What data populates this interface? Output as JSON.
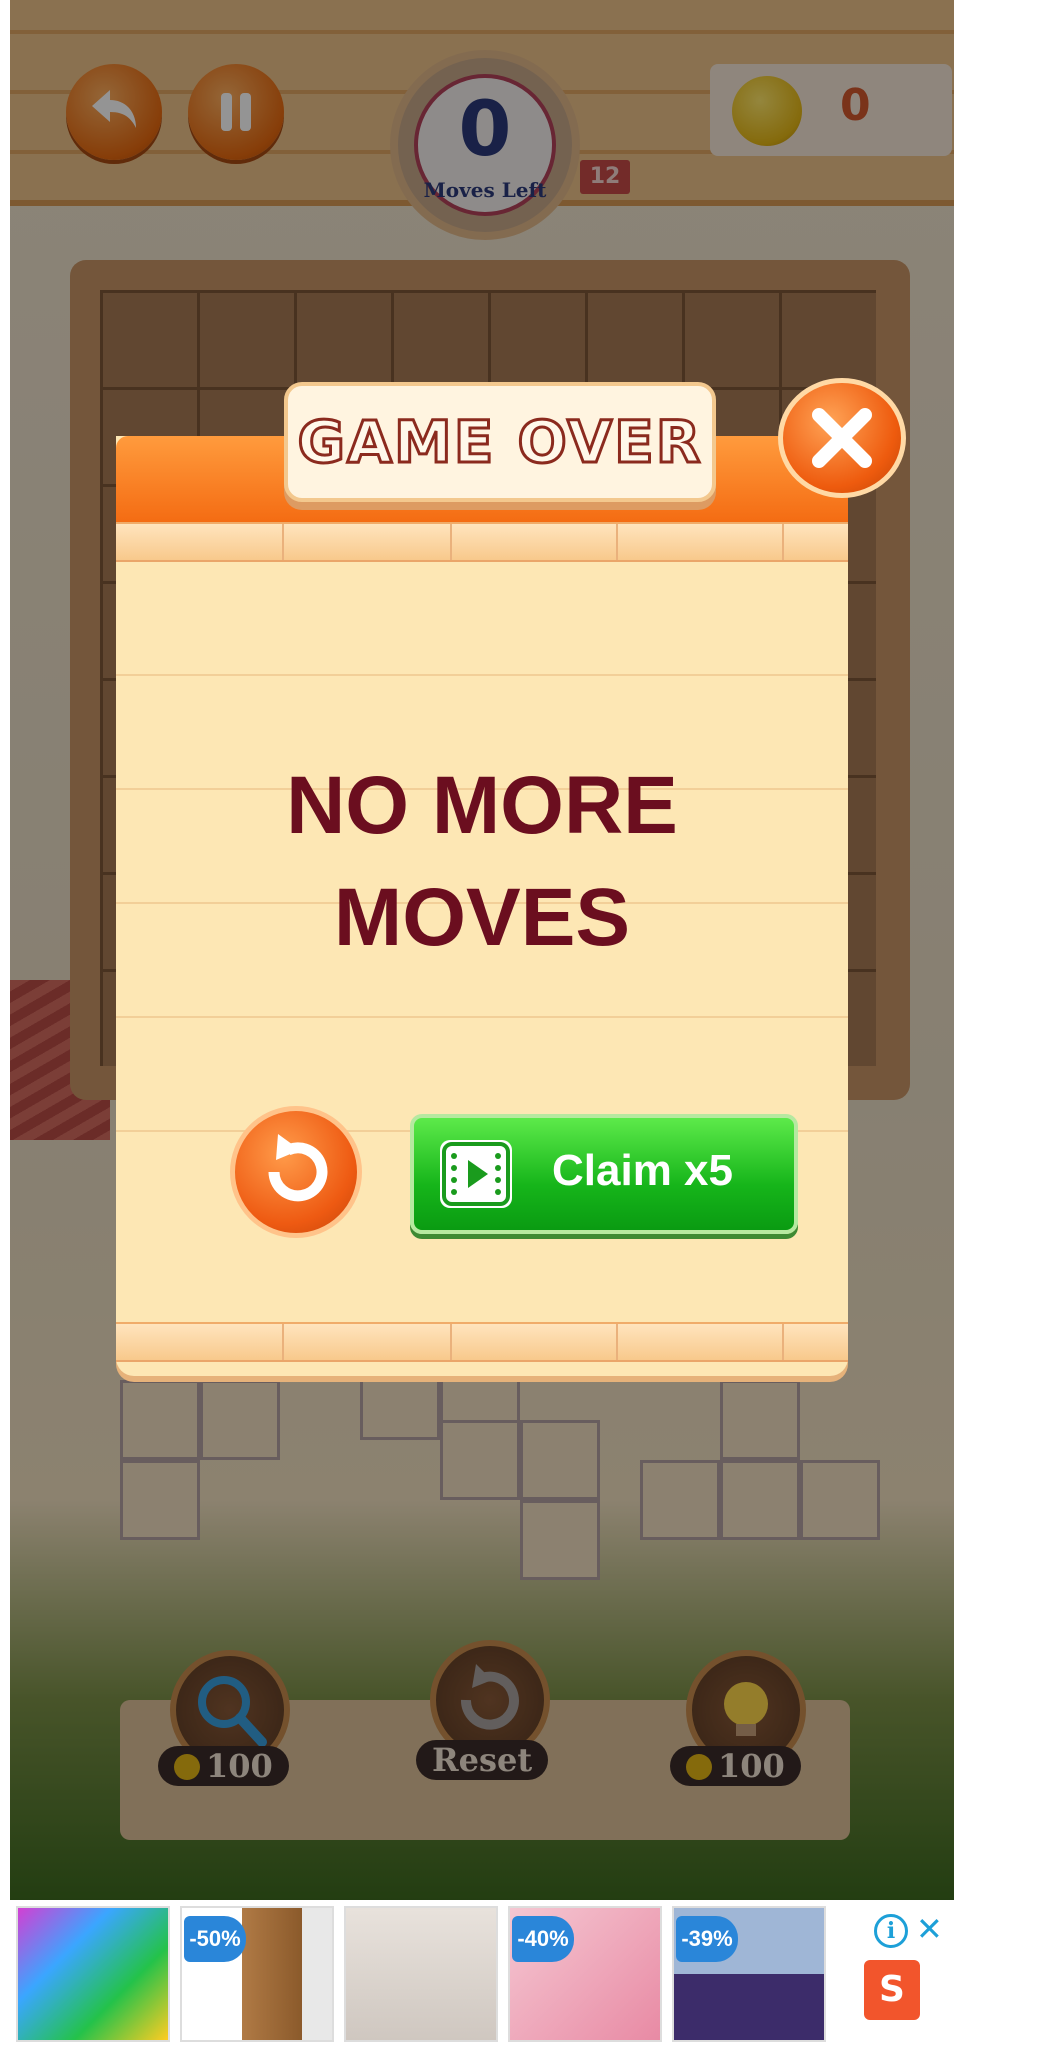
{
  "header": {
    "moves_left_value": "0",
    "moves_left_label": "Moves Left",
    "level": "12",
    "coins": "0"
  },
  "boosters": [
    {
      "name": "search",
      "price": "100"
    },
    {
      "name": "reset",
      "label": "Reset"
    },
    {
      "name": "hint",
      "price": "100"
    }
  ],
  "dialog": {
    "title": "GAME OVER",
    "message_line1": "NO MORE",
    "message_line2": "MOVES",
    "claim_label": "Claim x5"
  },
  "ad": {
    "badges": [
      "-50%",
      "-40%",
      "-39%"
    ],
    "shop_glyph": "S"
  },
  "colors": {
    "dialog_bg": "#fde7b4",
    "dialog_header": "#f46b12",
    "message_text": "#6b0e1f",
    "claim_green": "#16b51a",
    "ad_accent": "#1da0d8"
  }
}
